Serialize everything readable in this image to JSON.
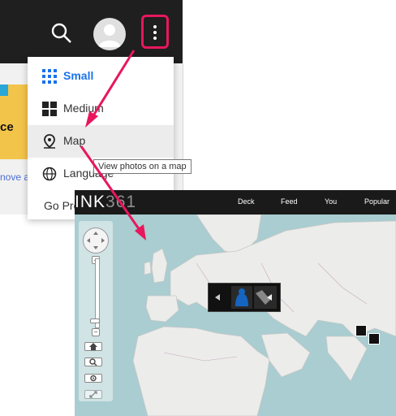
{
  "menu": {
    "items": [
      {
        "label": "Small"
      },
      {
        "label": "Medium"
      },
      {
        "label": "Map"
      },
      {
        "label": "Language"
      },
      {
        "label": "Go Pro"
      }
    ],
    "tooltip": "View photos on a map"
  },
  "page": {
    "ad_text": "ce",
    "ad_link": "nove a"
  },
  "map_site": {
    "brand_primary": "INK",
    "brand_secondary": "361",
    "nav": [
      "Deck",
      "Feed",
      "You",
      "Popular"
    ],
    "zoom_in": "+",
    "zoom_out": "−"
  },
  "colors": {
    "topbar": "#1f1f1f",
    "highlight": "#e8175d",
    "accent_blue": "#1a73e8",
    "water": "#a9cdd0",
    "land": "#ececea"
  }
}
